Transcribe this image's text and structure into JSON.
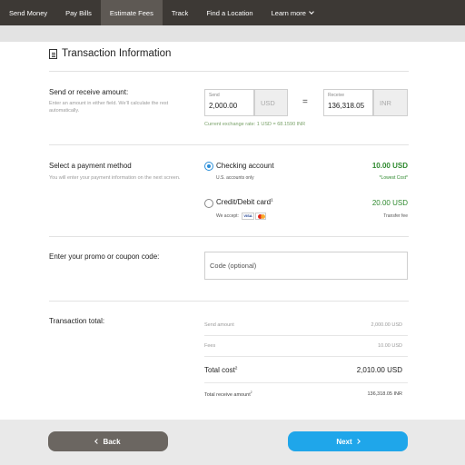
{
  "nav": {
    "items": [
      "Send Money",
      "Pay Bills",
      "Estimate Fees",
      "Track",
      "Find a Location",
      "Learn more"
    ],
    "active": "Estimate Fees"
  },
  "page": {
    "title": "Transaction Information"
  },
  "amount": {
    "title": "Send or receive amount:",
    "desc": "Enter an amount in either field. We'll calculate the rest automatically.",
    "send_label": "Send",
    "send_value": "2,000.00",
    "send_currency": "USD",
    "equals": "=",
    "receive_label": "Receive",
    "receive_value": "136,318.05",
    "receive_currency": "INR",
    "rate": "Current exchange rate: 1 USD = 68.1590 INR"
  },
  "payment": {
    "title": "Select a payment method",
    "desc": "You will enter your payment information on the next screen.",
    "options": [
      {
        "label": "Checking account",
        "sub": "U.S. accounts only",
        "price": "10.00 USD",
        "note": "*Lowest Cost*",
        "selected": true
      },
      {
        "label": "Credit/Debit card",
        "sup": "1",
        "sub": "We accept:",
        "price": "20.00 USD",
        "note": "Transfer fee",
        "selected": false
      }
    ],
    "card_brand": "VISA"
  },
  "promo": {
    "title": "Enter your promo or coupon code:",
    "placeholder": "Code (optional)"
  },
  "totals": {
    "title": "Transaction total:",
    "send_amount_label": "Send amount",
    "send_amount_value": "2,000.00 USD",
    "fees_label": "Fees",
    "fees_value": "10.00 USD",
    "total_cost_label": "Total cost",
    "total_cost_sup": "2",
    "total_cost_value": "2,010.00 USD",
    "total_receive_label": "Total receive amount",
    "total_receive_sup": "2",
    "total_receive_value": "136,318.05 INR"
  },
  "buttons": {
    "back": "Back",
    "next": "Next"
  },
  "colors": {
    "nav_bg": "#3d3935",
    "accent_blue": "#1fa6ea",
    "green": "#2f8a2f",
    "back_btn": "#6b6661"
  }
}
